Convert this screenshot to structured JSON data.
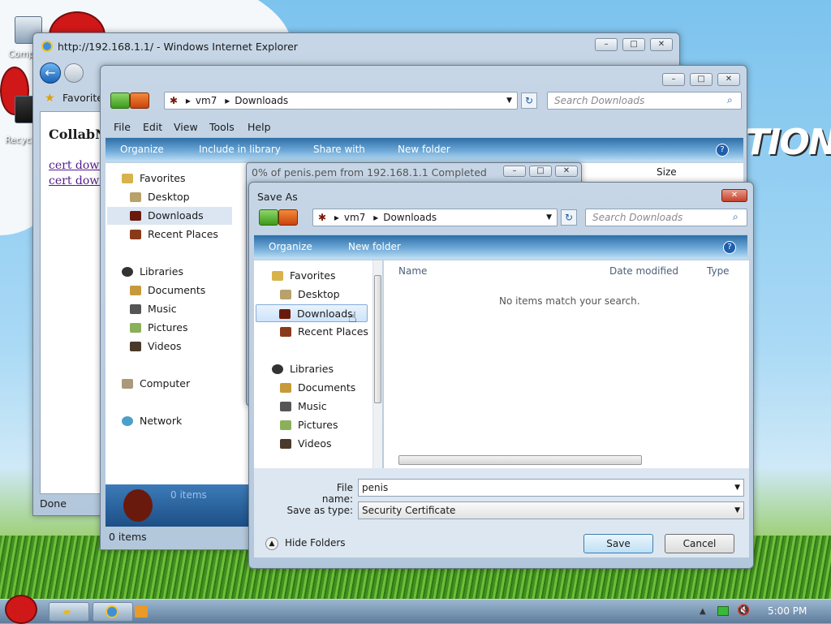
{
  "desktop": {
    "icons": [
      {
        "label": "Comp"
      },
      {
        "label": "Recyc"
      }
    ],
    "brand_text": "TION"
  },
  "ie_window": {
    "title": "http://192.168.1.1/ - Windows Internet Explorer",
    "favorites_label": "Favorite",
    "page_heading": "CollabN",
    "links": [
      "cert downl",
      "cert downl"
    ],
    "status": "Done"
  },
  "explorer_window": {
    "breadcrumb": [
      "vm7",
      "Downloads"
    ],
    "search_placeholder": "Search Downloads",
    "menu": [
      "File",
      "Edit",
      "View",
      "Tools",
      "Help"
    ],
    "toolbar": [
      "Organize",
      "Include in library",
      "Share with",
      "New folder"
    ],
    "nav_items": [
      {
        "label": "Favorites",
        "icon": "star-icon"
      },
      {
        "label": "Desktop",
        "icon": "desktop-icon"
      },
      {
        "label": "Downloads",
        "icon": "downloads-icon"
      },
      {
        "label": "Recent Places",
        "icon": "recent-icon"
      },
      {
        "label": "Libraries",
        "icon": "libraries-icon"
      },
      {
        "label": "Documents",
        "icon": "documents-icon"
      },
      {
        "label": "Music",
        "icon": "music-icon"
      },
      {
        "label": "Pictures",
        "icon": "pictures-icon"
      },
      {
        "label": "Videos",
        "icon": "videos-icon"
      },
      {
        "label": "Computer",
        "icon": "computer-icon"
      },
      {
        "label": "Network",
        "icon": "network-icon"
      }
    ],
    "column_size": "Size",
    "details_count": "0 items",
    "status_count": "0 items"
  },
  "download_window": {
    "title": "0% of penis.pem from 192.168.1.1 Completed"
  },
  "save_dialog": {
    "title": "Save As",
    "breadcrumb": [
      "vm7",
      "Downloads"
    ],
    "search_placeholder": "Search Downloads",
    "toolbar": [
      "Organize",
      "New folder"
    ],
    "tree": [
      {
        "label": "Favorites"
      },
      {
        "label": "Desktop"
      },
      {
        "label": "Downloads"
      },
      {
        "label": "Recent Places"
      },
      {
        "label": "Libraries"
      },
      {
        "label": "Documents"
      },
      {
        "label": "Music"
      },
      {
        "label": "Pictures"
      },
      {
        "label": "Videos"
      }
    ],
    "columns": [
      "Name",
      "Date modified",
      "Type"
    ],
    "empty_message": "No items match your search.",
    "file_name_label": "File name:",
    "file_name_value": "penis",
    "save_type_label": "Save as type:",
    "save_type_value": "Security Certificate",
    "hide_folders": "Hide Folders",
    "save_button": "Save",
    "cancel_button": "Cancel"
  },
  "taskbar": {
    "clock": "5:00 PM"
  }
}
